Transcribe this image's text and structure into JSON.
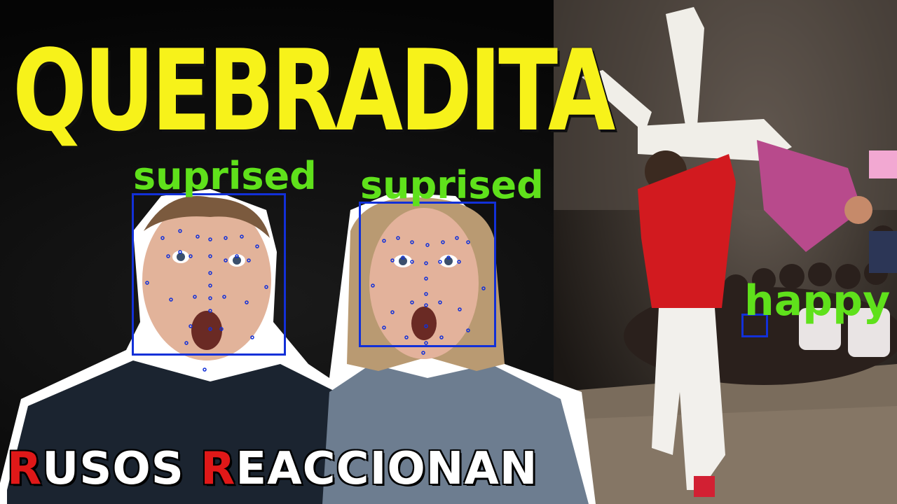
{
  "thumbnail": {
    "title": "QUEBRADITA",
    "caption": {
      "first_initial": "R",
      "first_rest": "USOS ",
      "second_initial": "R",
      "second_rest": "EACCIONAN"
    },
    "colors": {
      "title": "#f7f21a",
      "caption_text": "#ffffff",
      "caption_accent": "#e01818",
      "detection_box": "#1230d8",
      "emotion_label": "#5fe11b"
    }
  },
  "detections": [
    {
      "emotion": "suprised"
    },
    {
      "emotion": "suprised"
    },
    {
      "emotion": "happy"
    }
  ]
}
